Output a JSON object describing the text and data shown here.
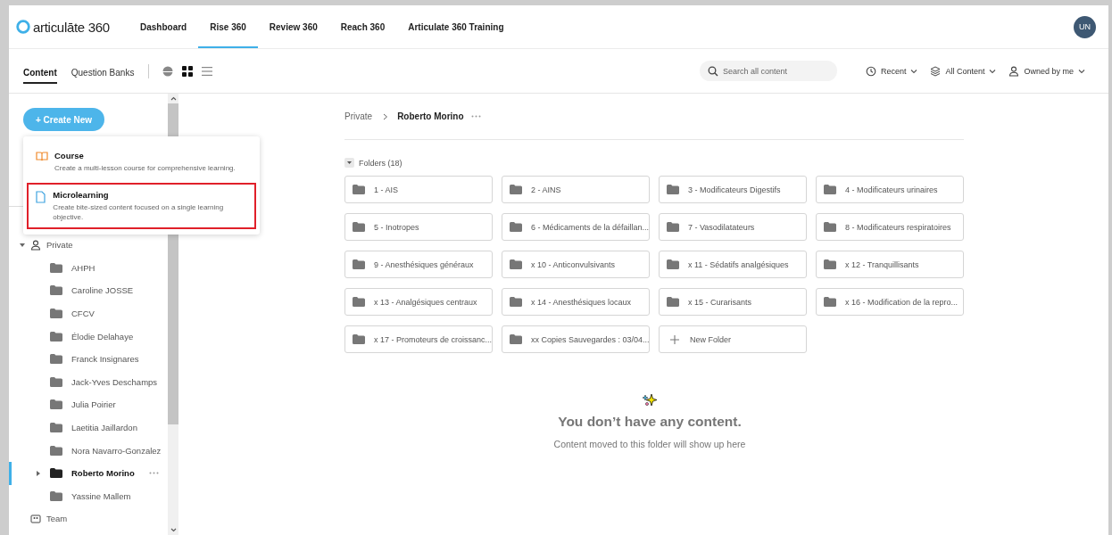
{
  "header": {
    "logo": "articulāte 360",
    "nav": [
      {
        "label": "Dashboard",
        "selected": false
      },
      {
        "label": "Rise 360",
        "selected": true
      },
      {
        "label": "Review 360",
        "selected": false
      },
      {
        "label": "Reach 360",
        "selected": false
      },
      {
        "label": "Articulate 360 Training",
        "selected": false
      }
    ],
    "avatar": "UN"
  },
  "toolbar": {
    "tabs": [
      {
        "label": "Content",
        "selected": true
      },
      {
        "label": "Question Banks",
        "selected": false
      }
    ],
    "view_modes": [
      {
        "kind": "theme",
        "selected": false
      },
      {
        "kind": "grid",
        "selected": true
      },
      {
        "kind": "list",
        "selected": false
      }
    ],
    "search": {
      "placeholder": "Search all content"
    },
    "filters": [
      {
        "kind": "recent",
        "label": "Recent"
      },
      {
        "kind": "type",
        "label": "All Content"
      },
      {
        "kind": "owner",
        "label": "Owned by me"
      }
    ]
  },
  "sidebar": {
    "create_button": "+ Create New",
    "create_menu": [
      {
        "kind": "course",
        "title": "Course",
        "description": "Create a multi-lesson course for comprehensive learning.",
        "highlighted": false
      },
      {
        "kind": "microlearning",
        "title": "Microlearning",
        "description": "Create bite-sized content focused on a single learning objective.",
        "highlighted": true
      }
    ],
    "tree": [
      {
        "kind": "user",
        "label": "Private",
        "expanded": true,
        "selected": false,
        "children": [
          {
            "kind": "folder",
            "label": "AHPH",
            "selected": false
          },
          {
            "kind": "folder",
            "label": "Caroline JOSSE",
            "selected": false
          },
          {
            "kind": "folder",
            "label": "CFCV",
            "selected": false
          },
          {
            "kind": "folder",
            "label": "Élodie Delahaye",
            "selected": false
          },
          {
            "kind": "folder",
            "label": "Franck Insignares",
            "selected": false
          },
          {
            "kind": "folder",
            "label": "Jack-Yves Deschamps",
            "selected": false
          },
          {
            "kind": "folder",
            "label": "Julia Poirier",
            "selected": false
          },
          {
            "kind": "folder",
            "label": "Laetitia Jaillardon",
            "selected": false
          },
          {
            "kind": "folder",
            "label": "Nora Navarro-Gonzalez",
            "selected": false
          },
          {
            "kind": "folder",
            "label": "Roberto Morino",
            "selected": true,
            "expanded": false
          },
          {
            "kind": "folder",
            "label": "Yassine Mallem",
            "selected": false
          }
        ]
      },
      {
        "kind": "team",
        "label": "Team",
        "selected": false
      }
    ]
  },
  "main": {
    "breadcrumb": [
      "Private",
      "Roberto Morino"
    ],
    "folders_heading": "Folders (18)",
    "folders_expanded": true,
    "folders": [
      "1 - AIS",
      "2 - AINS",
      "3 - Modificateurs Digestifs",
      "4 - Modificateurs urinaires",
      "5 - Inotropes",
      "6 - Médicaments de la défaillan...",
      "7 - Vasodilatateurs",
      "8 - Modificateurs respiratoires",
      "9 - Anesthésiques généraux",
      "x 10 - Anticonvulsivants",
      "x 11 - Sédatifs analgésiques",
      "x 12 - Tranquillisants",
      "x 13 - Analgésiques centraux",
      "x 14 - Anesthésiques locaux",
      "x 15 - Curarisants",
      "x 16 - Modification de la repro...",
      "x 17 - Promoteurs de croissanc...",
      "xx Copies Sauvegardes : 03/04..."
    ],
    "new_folder": "New Folder",
    "empty_title": "You don’t have any content.",
    "empty_text": "Content moved to this folder will show up here"
  }
}
